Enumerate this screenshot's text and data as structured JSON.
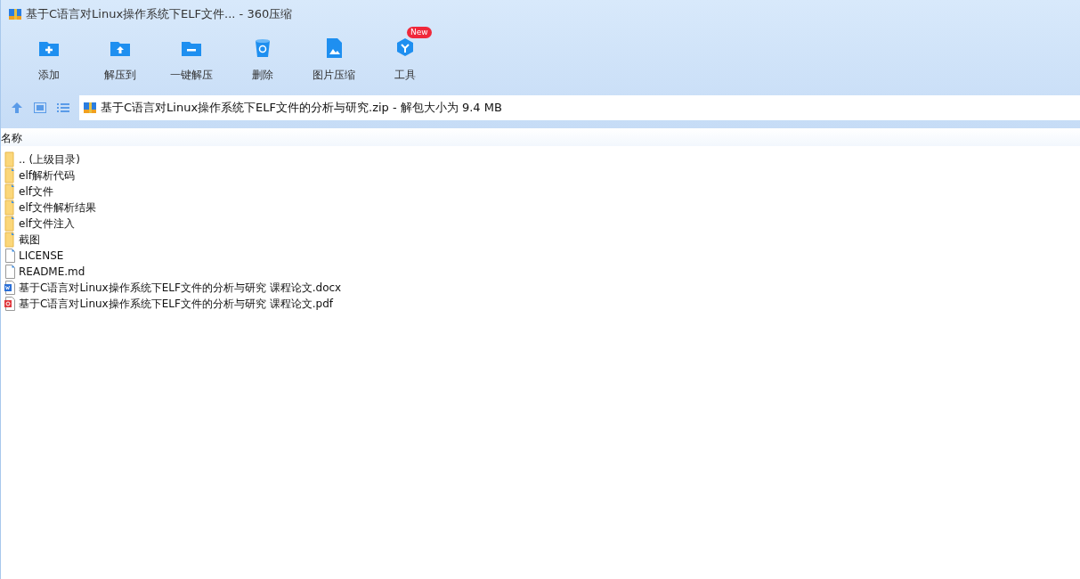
{
  "window": {
    "title": "基于C语言对Linux操作系统下ELF文件... - 360压缩"
  },
  "toolbar": [
    {
      "kind": "add",
      "label": "添加"
    },
    {
      "kind": "extract",
      "label": "解压到"
    },
    {
      "kind": "oneclick",
      "label": "一键解压"
    },
    {
      "kind": "delete",
      "label": "删除"
    },
    {
      "kind": "image",
      "label": "图片压缩"
    },
    {
      "kind": "tools",
      "label": "工具",
      "badge": "New"
    }
  ],
  "address": {
    "text": "基于C语言对Linux操作系统下ELF文件的分析与研究.zip - 解包大小为 9.4 MB"
  },
  "table": {
    "columns": [
      "名称"
    ],
    "rows": [
      {
        "kind": "parent",
        "name": ".. (上级目录)"
      },
      {
        "kind": "folder",
        "name": "elf解析代码"
      },
      {
        "kind": "folder",
        "name": "elf文件"
      },
      {
        "kind": "folder",
        "name": "elf文件解析结果"
      },
      {
        "kind": "folder",
        "name": "elf文件注入"
      },
      {
        "kind": "folder",
        "name": "截图"
      },
      {
        "kind": "file",
        "name": "LICENSE"
      },
      {
        "kind": "file",
        "name": "README.md"
      },
      {
        "kind": "docx",
        "name": "基于C语言对Linux操作系统下ELF文件的分析与研究 课程论文.docx"
      },
      {
        "kind": "pdf",
        "name": "基于C语言对Linux操作系统下ELF文件的分析与研究 课程论文.pdf"
      }
    ]
  }
}
